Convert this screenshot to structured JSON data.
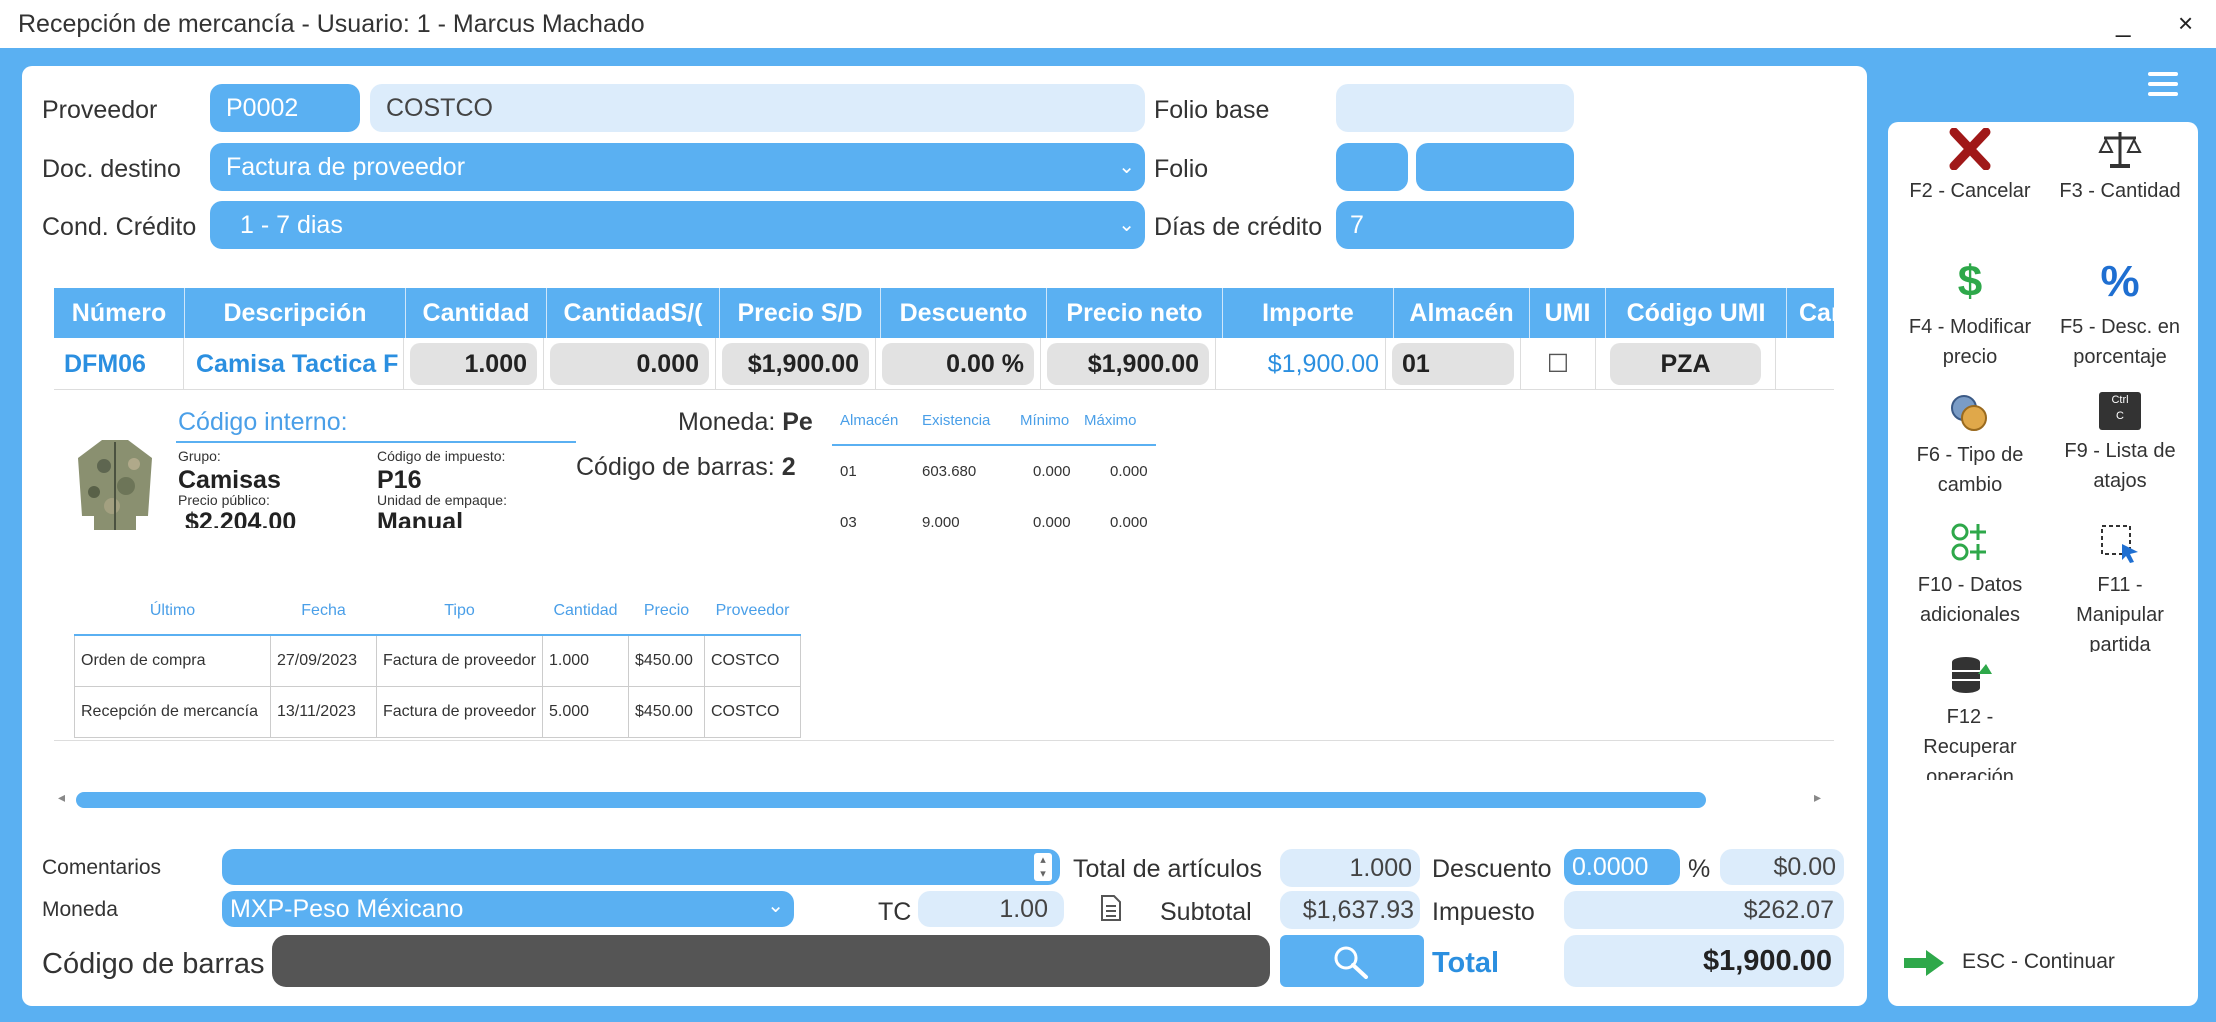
{
  "window": {
    "title": "Recepción de mercancía - Usuario: 1 - Marcus  Machado",
    "minimize": "_",
    "close": "×"
  },
  "header": {
    "proveedor_label": "Proveedor",
    "proveedor_code": "P0002",
    "proveedor_name": "COSTCO",
    "doc_destino_label": "Doc. destino",
    "doc_destino_value": "Factura de proveedor",
    "cond_credito_label": "Cond. Crédito",
    "cond_credito_value": "1 - 7 dias",
    "folio_base_label": "Folio base",
    "folio_base_value": "",
    "folio_label": "Folio",
    "dias_credito_label": "Días de crédito",
    "dias_credito_value": "7"
  },
  "grid": {
    "columns": [
      "Número",
      "Descripción",
      "Cantidad",
      "CantidadS/(",
      "Precio S/D",
      "Descuento",
      "Precio neto",
      "Importe",
      "Almacén",
      "UMI",
      "Código UMI",
      "Cantic"
    ],
    "row": {
      "numero": "DFM06",
      "descripcion": "Camisa Tactica F",
      "cantidad": "1.000",
      "cantidad_s": "0.000",
      "precio_sd": "$1,900.00",
      "descuento": "0.00 %",
      "precio_neto": "$1,900.00",
      "importe": "$1,900.00",
      "almacen": "01",
      "umi": "☐",
      "codigo_umi": "PZA"
    }
  },
  "detail": {
    "codigo_interno_label": "Código interno:",
    "grupo_label": "Grupo:",
    "grupo_value": "Camisas",
    "codigo_impuesto_label": "Código de impuesto:",
    "codigo_impuesto_value": "P16",
    "precio_publico_label": "Precio público:",
    "precio_publico_value": "$2,204.00",
    "unidad_empaque_label": "Unidad de empaque:",
    "unidad_empaque_value": "Manual",
    "moneda_label": "Moneda:",
    "moneda_value": "Pe",
    "codigo_barras_label": "Código de barras:",
    "codigo_barras_value": "2"
  },
  "stock": {
    "headers": [
      "Almacén",
      "Existencia",
      "Mínimo",
      "Máximo"
    ],
    "rows": [
      [
        "01",
        "603.680",
        "0.000",
        "0.000"
      ],
      [
        "03",
        "9.000",
        "0.000",
        "0.000"
      ]
    ]
  },
  "history": {
    "headers": [
      "Último",
      "Fecha",
      "Tipo",
      "Cantidad",
      "Precio",
      "Proveedor"
    ],
    "rows": [
      [
        "Orden de compra",
        "27/09/2023",
        "Factura de proveedor",
        "1.000",
        "$450.00",
        "COSTCO"
      ],
      [
        "Recepción de mercancía",
        "13/11/2023",
        "Factura de proveedor",
        "5.000",
        "$450.00",
        "COSTCO"
      ]
    ]
  },
  "footer": {
    "comentarios_label": "Comentarios",
    "comentarios_value": "",
    "moneda_label": "Moneda",
    "moneda_value": "MXP-Peso Méxicano",
    "tc_label": "TC",
    "tc_value": "1.00",
    "codigo_barras_label": "Código de barras",
    "codigo_barras_value": "",
    "total_articulos_label": "Total de artículos",
    "total_articulos_value": "1.000",
    "subtotal_label": "Subtotal",
    "subtotal_value": "$1,637.93",
    "total_label": "Total",
    "total_value": "$1,900.00",
    "descuento_label": "Descuento",
    "descuento_value": "0.0000",
    "percent": "%",
    "descuento_amount": "$0.00",
    "impuesto_label": "Impuesto",
    "impuesto_value": "$262.07"
  },
  "actions": {
    "f2": "F2 - Cancelar",
    "f3": "F3 - Cantidad",
    "f4_a": "F4 - Modificar",
    "f4_b": "precio",
    "f5_a": "F5 - Desc. en",
    "f5_b": "porcentaje",
    "f6_a": "F6 - Tipo de",
    "f6_b": "cambio",
    "f9_a": "F9 - Lista de",
    "f9_b": "atajos",
    "f10_a": "F10 - Datos",
    "f10_b": "adicionales",
    "f11_a": "F11 -",
    "f11_b": "Manipular",
    "f11_c": "partida",
    "f12_a": "F12 -",
    "f12_b": "Recuperar",
    "f12_c": "operación",
    "esc": "ESC - Continuar",
    "dollar_glyph": "$",
    "percent_glyph": "%",
    "ctrl_text": "Ctrl",
    "c_text": "C"
  },
  "colors": {
    "accent": "#5ab0f2",
    "field_light": "#dcecfb",
    "link_blue": "#2b8fe0",
    "cancel_red": "#a01818",
    "money_green": "#2ea84a"
  }
}
